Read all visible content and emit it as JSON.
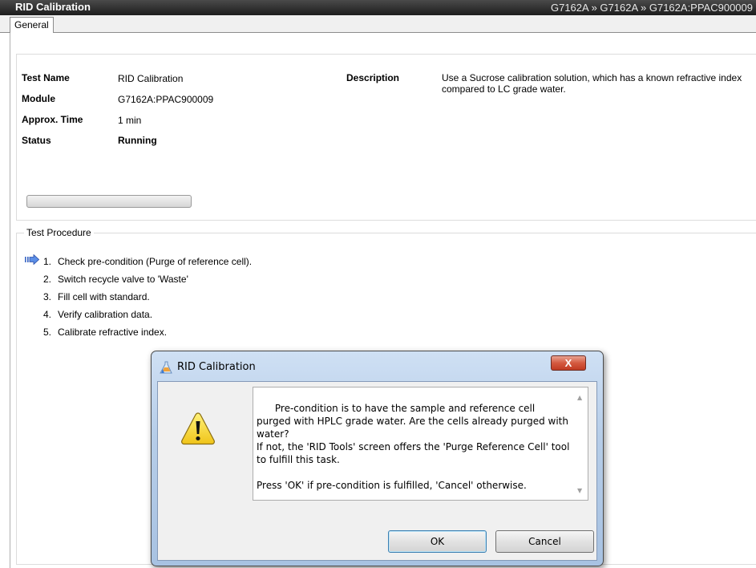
{
  "window": {
    "title": "RID Calibration",
    "breadcrumb": "G7162A » G7162A » G7162A:PPAC900009"
  },
  "tabs": [
    {
      "label": "General"
    }
  ],
  "info": {
    "test_name_label": "Test Name",
    "test_name_value": "RID Calibration",
    "module_label": "Module",
    "module_value": "G7162A:PPAC900009",
    "time_label": "Approx. Time",
    "time_value": "1 min",
    "status_label": "Status",
    "status_value": "Running",
    "description_label": "Description",
    "description_value": "Use a Sucrose calibration solution, which has a known refractive index compared to LC grade water.",
    "progress": 0
  },
  "procedure": {
    "title": "Test Procedure",
    "current_step_icon": "current-step-arrow-icon",
    "steps": [
      {
        "num": "1.",
        "text": "Check pre-condition (Purge of reference cell)."
      },
      {
        "num": "2.",
        "text": "Switch recycle valve to 'Waste'"
      },
      {
        "num": "3.",
        "text": "Fill cell with standard."
      },
      {
        "num": "4.",
        "text": "Verify calibration data."
      },
      {
        "num": "5.",
        "text": "Calibrate refractive index."
      }
    ]
  },
  "dialog": {
    "title": "RID Calibration",
    "close_label": "X",
    "icon": "warning-icon",
    "message": "Pre-condition is to have the sample and reference cell purged with HPLC grade water. Are the cells already purged with water?\nIf not, the 'RID Tools' screen offers the 'Purge Reference Cell' tool to fulfill this task.\n\nPress 'OK' if pre-condition is fulfilled, 'Cancel' otherwise.",
    "ok_label": "OK",
    "cancel_label": "Cancel"
  },
  "colors": {
    "titlebar": "#1d1d1d",
    "dialog_frame": "#b6cde8",
    "close_button": "#d45a3f",
    "warning": "#f3d21f"
  }
}
